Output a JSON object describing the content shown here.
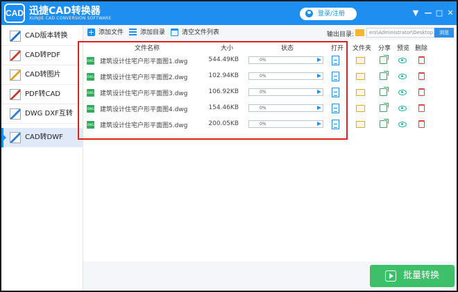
{
  "app": {
    "logo_text": "CAD",
    "title": "迅捷CAD转换器",
    "subtitle": "XUNJIE CAD CONVERSION SOFTWARE",
    "login_label": "登录/注册",
    "window_controls": [
      "▼",
      "—",
      "□",
      "✕"
    ]
  },
  "sidebar": {
    "items": [
      {
        "label": "CAD版本转换",
        "icon": "cad-version-icon"
      },
      {
        "label": "CAD转PDF",
        "icon": "cad-to-pdf-icon"
      },
      {
        "label": "CAD转图片",
        "icon": "cad-to-image-icon"
      },
      {
        "label": "PDF转CAD",
        "icon": "pdf-to-cad-icon"
      },
      {
        "label": "DWG DXF互转",
        "icon": "dwg-dxf-icon"
      },
      {
        "label": "CAD转DWF",
        "icon": "cad-to-dwf-icon"
      }
    ],
    "active_index": 5
  },
  "toolbar": {
    "add_file": "添加文件",
    "add_dir": "添加目录",
    "clear_list": "清空文件列表",
    "output_label": "输出目录:",
    "output_path": "ers\\Administrator\\Desktop",
    "browse": "浏览"
  },
  "columns": {
    "name": "文件名称",
    "size": "大小",
    "status": "状态",
    "open": "打开",
    "folder": "文件夹",
    "share": "分享",
    "preview": "预览",
    "delete": "删除"
  },
  "files": [
    {
      "name": "建筑设计住宅户形平面图1.dwg",
      "size": "544.49KB",
      "progress": "0%",
      "icon": "DWG"
    },
    {
      "name": "建筑设计住宅户形平面图2.dwg",
      "size": "102.94KB",
      "progress": "0%",
      "icon": "DWG"
    },
    {
      "name": "建筑设计住宅户形平面图3.dwg",
      "size": "106.92KB",
      "progress": "0%",
      "icon": "DWG"
    },
    {
      "name": "建筑设计住宅户形平面图4.dwg",
      "size": "154.46KB",
      "progress": "0%",
      "icon": "DWG"
    },
    {
      "name": "建筑设计住宅户形平面图5.dwg",
      "size": "200.05KB",
      "progress": "0%",
      "icon": "DWG"
    }
  ],
  "batch_button": "批量转换",
  "colors": {
    "brand": "#1e8ff0",
    "action_green": "#3dc06a",
    "highlight_red": "#e02020"
  }
}
